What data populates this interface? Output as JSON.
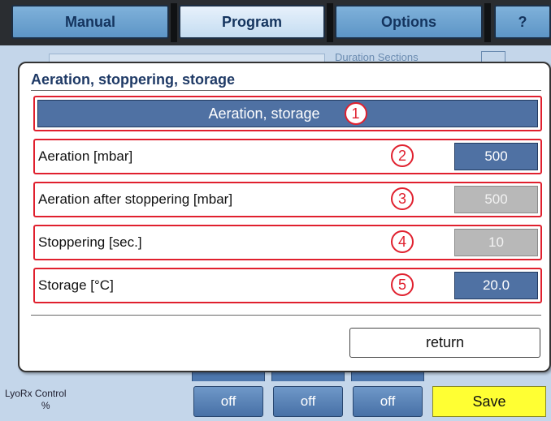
{
  "tabs": [
    {
      "label": "Manual"
    },
    {
      "label": "Program"
    },
    {
      "label": "Options"
    },
    {
      "label": "?"
    }
  ],
  "background": {
    "duration_label": "Duration  Sections",
    "lyorx_label": "LyoRx Control",
    "lyorx_unit": "%",
    "off_buttons": [
      "off",
      "off",
      "off"
    ],
    "save_label": "Save"
  },
  "dialog": {
    "title": "Aeration, stoppering, storage",
    "header": {
      "label": "Aeration, storage",
      "number": "1"
    },
    "rows": [
      {
        "label": "Aeration [mbar]",
        "number": "2",
        "value": "500",
        "enabled": true
      },
      {
        "label": "Aeration after stoppering [mbar]",
        "number": "3",
        "value": "500",
        "enabled": false
      },
      {
        "label": "Stoppering [sec.]",
        "number": "4",
        "value": "10",
        "enabled": false
      },
      {
        "label": "Storage [°C]",
        "number": "5",
        "value": "20.0",
        "enabled": true
      }
    ],
    "return_label": "return"
  },
  "colors": {
    "accent_blue": "#4f71a3",
    "annotation_red": "#e0202e",
    "save_yellow": "#ffff33",
    "disabled_gray": "#b8b8b8"
  }
}
